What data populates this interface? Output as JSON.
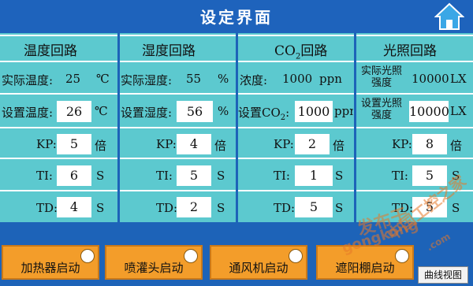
{
  "header": {
    "title": "设定界面",
    "home_icon": "home-icon"
  },
  "columns": [
    {
      "title_main": "温度回路",
      "title_sub": "",
      "actual_label": "实际温度:",
      "actual_value": "25",
      "actual_unit": "℃",
      "set_label": "设置温度:",
      "set_value": "26",
      "set_unit": "℃",
      "kp_label": "KP:",
      "kp_value": "5",
      "kp_unit": "倍",
      "ti_label": "TI:",
      "ti_value": "6",
      "ti_unit": "S",
      "td_label": "TD:",
      "td_value": "4",
      "td_unit": "S"
    },
    {
      "title_main": "湿度回路",
      "title_sub": "",
      "actual_label": "实际湿度:",
      "actual_value": "55",
      "actual_unit": "%",
      "set_label": "设置湿度:",
      "set_value": "56",
      "set_unit": "%",
      "kp_label": "KP:",
      "kp_value": "4",
      "kp_unit": "倍",
      "ti_label": "TI:",
      "ti_value": "5",
      "ti_unit": "S",
      "td_label": "TD:",
      "td_value": "2",
      "td_unit": "S"
    },
    {
      "title_main": "CO",
      "title_sub": "2",
      "title_rest": "回路",
      "actual_label": "浓度:",
      "actual_value": "1000",
      "actual_unit": "ppn",
      "set_label": "设置CO",
      "set_label_sub": "2",
      "set_label_rest": ":",
      "set_value": "1000",
      "set_unit": "ppn",
      "kp_label": "KP:",
      "kp_value": "2",
      "kp_unit": "倍",
      "ti_label": "TI:",
      "ti_value": "1",
      "ti_unit": "S",
      "td_label": "TD:",
      "td_value": "5",
      "td_unit": "S"
    },
    {
      "title_main": "光照回路",
      "title_sub": "",
      "actual_label_l1": "实际光照",
      "actual_label_l2": "强度",
      "actual_value": "10000",
      "actual_unit": "LX",
      "set_label_l1": "设置光照",
      "set_label_l2": "强度",
      "set_value": "10000",
      "set_unit": "LX",
      "kp_label": "KP:",
      "kp_value": "8",
      "kp_unit": "倍",
      "ti_label": "TI:",
      "ti_value": "5",
      "ti_unit": "S",
      "td_label": "TD:",
      "td_value": "5",
      "td_unit": "S"
    }
  ],
  "buttons": [
    {
      "label": "加热器启动"
    },
    {
      "label": "喷灌头启动"
    },
    {
      "label": "通风机启动"
    },
    {
      "label": "遮阳棚启动"
    }
  ],
  "curve_button": "曲线视图",
  "watermark": {
    "line1": "发布于",
    "line2": "gongkong",
    "line3": "中国工控之家",
    "line4": ".com"
  },
  "colors": {
    "panel": "#5cc9cf",
    "background": "#1d63b8",
    "button": "#f39d2a"
  }
}
